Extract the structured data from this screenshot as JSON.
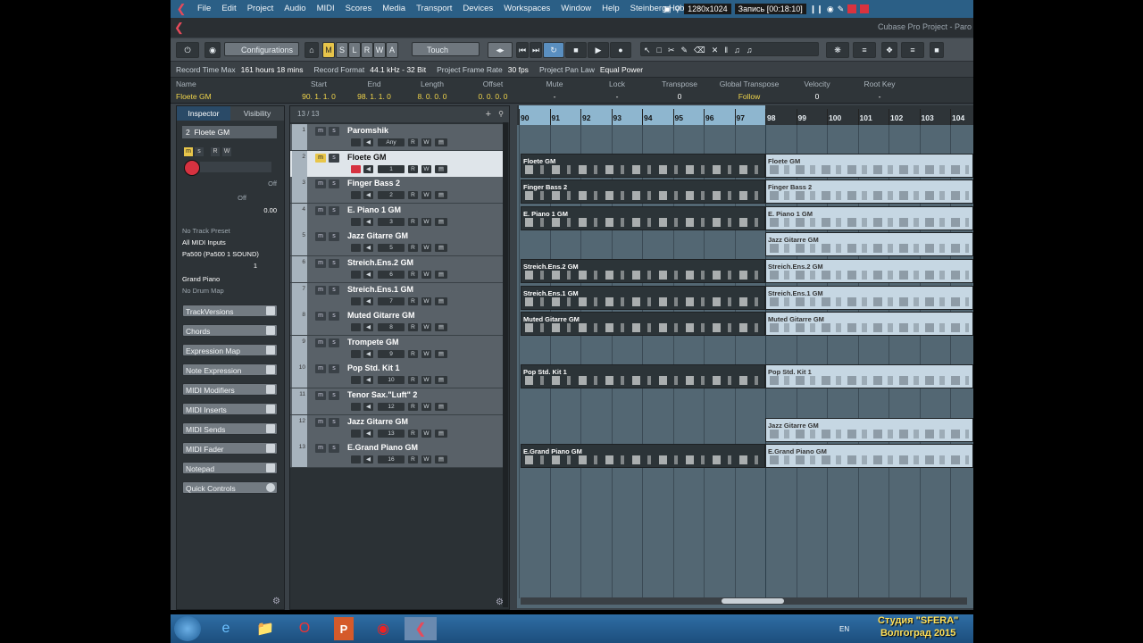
{
  "menu": {
    "items": [
      "File",
      "Edit",
      "Project",
      "Audio",
      "MIDI",
      "Scores",
      "Media",
      "Transport",
      "Devices",
      "Workspaces",
      "Window",
      "Help",
      "Steinberg Hub"
    ],
    "resolution": "1280x1024",
    "recording": "Запись [00:18:10]"
  },
  "title": "Cubase Pro Project - Paro",
  "toolbar": {
    "configurations": "Configurations",
    "m": "M",
    "s": "S",
    "l": "L",
    "r": "R",
    "w": "W",
    "a": "A",
    "automation_mode": "Touch"
  },
  "infoline": {
    "rec_time_label": "Record Time Max",
    "rec_time_value": "161 hours 18 mins",
    "rec_format_label": "Record Format",
    "rec_format_value": "44.1 kHz - 32 Bit",
    "frame_rate_label": "Project Frame Rate",
    "frame_rate_value": "30 fps",
    "pan_law_label": "Project Pan Law",
    "pan_law_value": "Equal Power"
  },
  "event": {
    "name_label": "Name",
    "name_value": "Floete GM",
    "start_label": "Start",
    "start_value": "90. 1. 1.   0",
    "end_label": "End",
    "end_value": "98. 1. 1.   0",
    "length_label": "Length",
    "length_value": "8. 0. 0.   0",
    "offset_label": "Offset",
    "offset_value": "0. 0. 0.   0",
    "mute_label": "Mute",
    "mute_value": "-",
    "lock_label": "Lock",
    "lock_value": "-",
    "transpose_label": "Transpose",
    "transpose_value": "0",
    "global_label": "Global Transpose",
    "global_value": "Follow",
    "velocity_label": "Velocity",
    "velocity_value": "0",
    "rootkey_label": "Root Key",
    "rootkey_value": "-"
  },
  "inspector": {
    "tab_inspector": "Inspector",
    "tab_visibility": "Visibility",
    "track_num": "2",
    "track_name": "Floete GM",
    "vol_off": "Off",
    "pan_off": "Off",
    "vol_value": "0.00",
    "preset": "No Track Preset",
    "input": "All MIDI Inputs",
    "output": "Pa500 (Pa500 1 SOUND)",
    "channel": "1",
    "program": "Grand Piano",
    "drum_map": "No Drum Map",
    "sections": [
      "TrackVersions",
      "Chords",
      "Expression Map",
      "Note Expression",
      "MIDI Modifiers",
      "MIDI Inserts",
      "MIDI Sends",
      "MIDI Fader",
      "Notepad",
      "Quick Controls"
    ]
  },
  "tracklist": {
    "count": "13 / 13",
    "tracks": [
      {
        "n": "1",
        "name": "Paromshik",
        "ch": "Any"
      },
      {
        "n": "2",
        "name": "Floete GM",
        "ch": "1"
      },
      {
        "n": "3",
        "name": "Finger Bass 2",
        "ch": "2"
      },
      {
        "n": "4",
        "name": "E. Piano 1 GM",
        "ch": "3"
      },
      {
        "n": "5",
        "name": "Jazz Gitarre GM",
        "ch": "5"
      },
      {
        "n": "6",
        "name": "Streich.Ens.2 GM",
        "ch": "6"
      },
      {
        "n": "7",
        "name": "Streich.Ens.1 GM",
        "ch": "7"
      },
      {
        "n": "8",
        "name": "Muted Gitarre GM",
        "ch": "8"
      },
      {
        "n": "9",
        "name": "Trompete GM",
        "ch": "9"
      },
      {
        "n": "10",
        "name": "Pop Std. Kit 1",
        "ch": "10"
      },
      {
        "n": "11",
        "name": "Tenor Sax.\"Luft\" 2",
        "ch": "12"
      },
      {
        "n": "12",
        "name": "Jazz Gitarre GM",
        "ch": "13"
      },
      {
        "n": "13",
        "name": "E.Grand Piano GM",
        "ch": "16"
      }
    ]
  },
  "ruler": {
    "bars": [
      "90",
      "91",
      "92",
      "93",
      "94",
      "95",
      "96",
      "97",
      "98",
      "99",
      "100",
      "101",
      "102",
      "103",
      "104"
    ]
  },
  "parts": {
    "floete": "Floete GM",
    "finger_bass": "Finger Bass 2",
    "epiano": "E. Piano 1 GM",
    "jazz": "Jazz Gitarre GM",
    "streich2": "Streich.Ens.2 GM",
    "streich1": "Streich.Ens.1 GM",
    "muted": "Muted Gitarre GM",
    "popkit": "Pop Std. Kit 1",
    "egrand": "E.Grand Piano GM"
  },
  "taskbar": {
    "lang": "EN",
    "studio_line1": "Студия \"SFERA\"",
    "studio_line2": "Волгоград 2015"
  }
}
